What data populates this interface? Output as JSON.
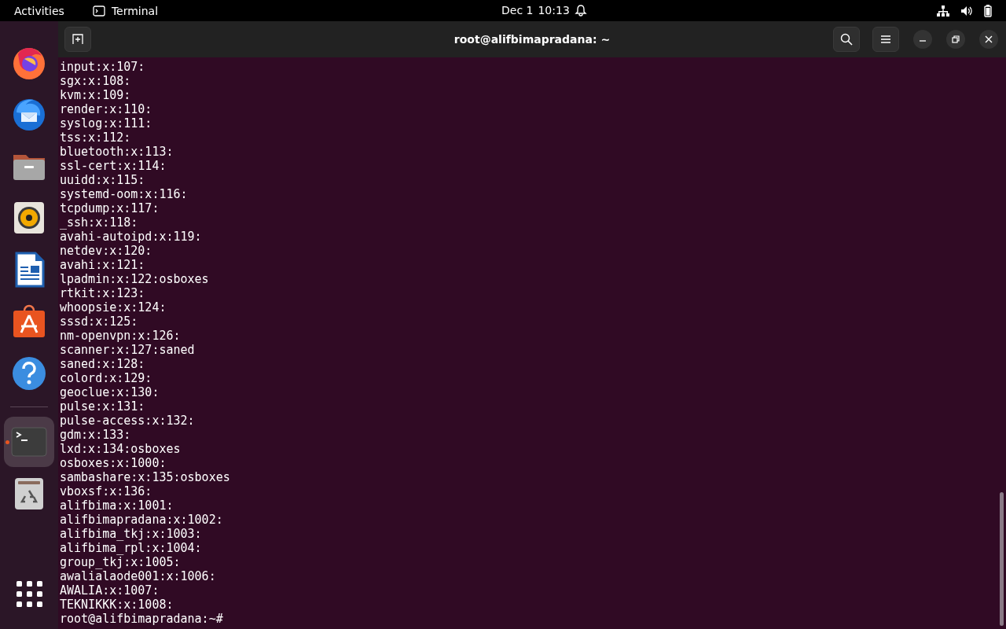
{
  "top_bar": {
    "activities": "Activities",
    "app_name": "Terminal",
    "date": "Dec 1",
    "time": "10:13"
  },
  "dock": {
    "items": [
      {
        "kind": "firefox",
        "selected": false,
        "running": false
      },
      {
        "kind": "thunderbird",
        "selected": false,
        "running": false
      },
      {
        "kind": "files",
        "selected": false,
        "running": false
      },
      {
        "kind": "rhythmbox",
        "selected": false,
        "running": false
      },
      {
        "kind": "writer",
        "selected": false,
        "running": false
      },
      {
        "kind": "software",
        "selected": false,
        "running": false
      },
      {
        "kind": "help",
        "selected": false,
        "running": false
      },
      {
        "kind": "separator"
      },
      {
        "kind": "terminal",
        "selected": true,
        "running": true
      },
      {
        "kind": "trash",
        "selected": false,
        "running": false
      }
    ]
  },
  "terminal": {
    "title": "root@alifbimapradana: ~",
    "lines": [
      "input:x:107:",
      "sgx:x:108:",
      "kvm:x:109:",
      "render:x:110:",
      "syslog:x:111:",
      "tss:x:112:",
      "bluetooth:x:113:",
      "ssl-cert:x:114:",
      "uuidd:x:115:",
      "systemd-oom:x:116:",
      "tcpdump:x:117:",
      "_ssh:x:118:",
      "avahi-autoipd:x:119:",
      "netdev:x:120:",
      "avahi:x:121:",
      "lpadmin:x:122:osboxes",
      "rtkit:x:123:",
      "whoopsie:x:124:",
      "sssd:x:125:",
      "nm-openvpn:x:126:",
      "scanner:x:127:saned",
      "saned:x:128:",
      "colord:x:129:",
      "geoclue:x:130:",
      "pulse:x:131:",
      "pulse-access:x:132:",
      "gdm:x:133:",
      "lxd:x:134:osboxes",
      "osboxes:x:1000:",
      "sambashare:x:135:osboxes",
      "vboxsf:x:136:",
      "alifbima:x:1001:",
      "alifbimapradana:x:1002:",
      "alifbima_tkj:x:1003:",
      "alifbima_rpl:x:1004:",
      "group_tkj:x:1005:",
      "awalialaode001:x:1006:",
      "AWALIA:x:1007:",
      "TEKNIKKK:x:1008:",
      "root@alifbimapradana:~#"
    ]
  }
}
